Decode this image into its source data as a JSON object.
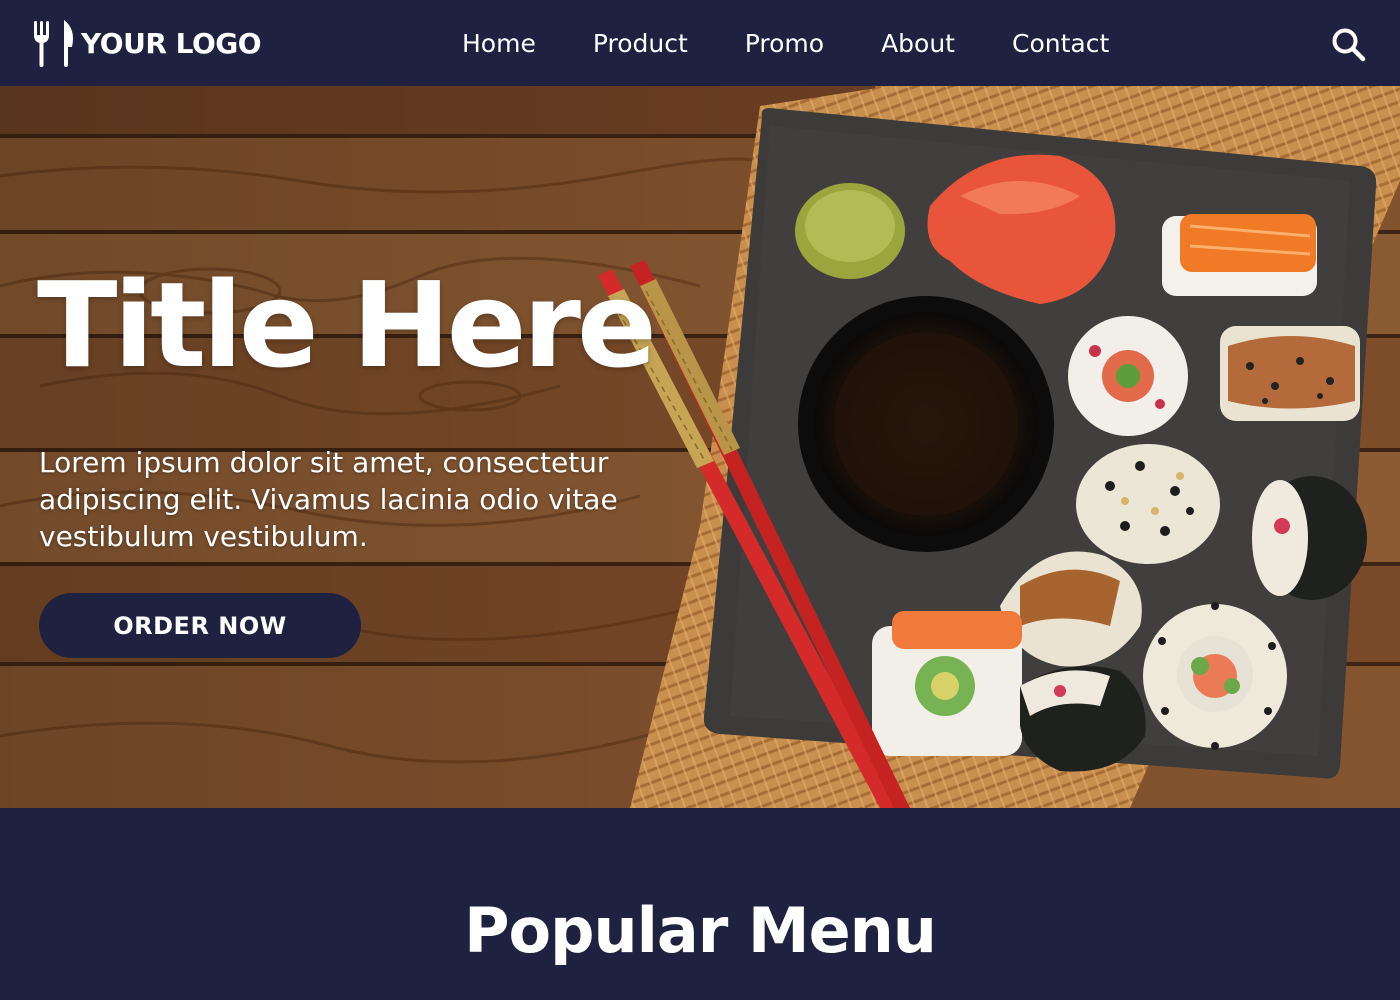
{
  "nav": {
    "logo_text": "YOUR LOGO",
    "links": [
      {
        "label": "Home"
      },
      {
        "label": "Product"
      },
      {
        "label": "Promo"
      },
      {
        "label": "About"
      },
      {
        "label": "Contact"
      }
    ],
    "search_icon": "search-icon"
  },
  "hero": {
    "title": "Title Here",
    "subtitle": "Lorem ipsum dolor sit amet, consectetur adipiscing elit. Vivamus lacinia odio vitae vestibulum vestibulum.",
    "cta_label": "ORDER NOW"
  },
  "popular": {
    "title": "Popular Menu"
  },
  "colors": {
    "navy": "#1e2240",
    "wood": "#7a4a28",
    "slate": "#3c3b39",
    "chopstick_red": "#d42a2a",
    "white": "#ffffff"
  }
}
